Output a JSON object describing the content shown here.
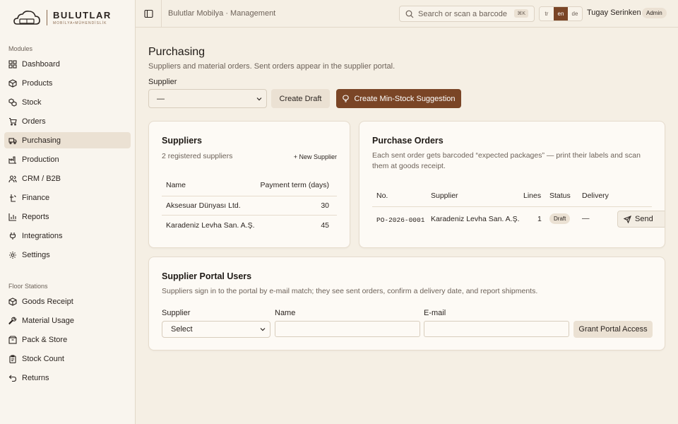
{
  "brand": {
    "name": "BULUTLAR",
    "tagline": "MOBİLYA•MÜHENDİSLİK"
  },
  "sidebar": {
    "modules_label": "Modules",
    "modules": [
      {
        "label": "Dashboard",
        "icon": "grid-icon"
      },
      {
        "label": "Products",
        "icon": "box-icon"
      },
      {
        "label": "Stock",
        "icon": "boxes-icon"
      },
      {
        "label": "Orders",
        "icon": "cart-icon"
      },
      {
        "label": "Purchasing",
        "icon": "truck-icon",
        "active": true
      },
      {
        "label": "Production",
        "icon": "factory-icon"
      },
      {
        "label": "CRM / B2B",
        "icon": "users-icon"
      },
      {
        "label": "Finance",
        "icon": "finance-icon"
      },
      {
        "label": "Reports",
        "icon": "chart-icon"
      },
      {
        "label": "Integrations",
        "icon": "plug-icon"
      },
      {
        "label": "Settings",
        "icon": "gear-icon"
      }
    ],
    "floor_label": "Floor Stations",
    "floor": [
      {
        "label": "Goods Receipt",
        "icon": "package-in-icon"
      },
      {
        "label": "Material Usage",
        "icon": "wrench-icon"
      },
      {
        "label": "Pack & Store",
        "icon": "package-icon"
      },
      {
        "label": "Stock Count",
        "icon": "clipboard-icon"
      },
      {
        "label": "Returns",
        "icon": "undo-icon"
      }
    ]
  },
  "topbar": {
    "breadcrumb": "Bulutlar Mobilya · Management",
    "search_placeholder": "Search or scan a barcode",
    "search_shortcut": "⌘K",
    "languages": [
      "tr",
      "en",
      "de"
    ],
    "active_language": "en",
    "user_name": "Tugay Serinken",
    "user_role": "Admin"
  },
  "page": {
    "title": "Purchasing",
    "description": "Suppliers and material orders. Sent orders appear in the supplier portal.",
    "supplier_label": "Supplier",
    "supplier_value": "—",
    "create_draft": "Create Draft",
    "create_suggestion": "Create Min-Stock Suggestion"
  },
  "suppliers": {
    "title": "Suppliers",
    "count_text": "2 registered suppliers",
    "new_button": "+ New Supplier",
    "columns": [
      "Name",
      "Payment term (days)"
    ],
    "rows": [
      {
        "name": "Aksesuar Dünyası Ltd.",
        "term": "30"
      },
      {
        "name": "Karadeniz Levha San. A.Ş.",
        "term": "45"
      }
    ]
  },
  "purchase_orders": {
    "title": "Purchase Orders",
    "description": "Each sent order gets barcoded “expected packages” — print their labels and scan them at goods receipt.",
    "columns": [
      "No.",
      "Supplier",
      "Lines",
      "Status",
      "Delivery"
    ],
    "rows": [
      {
        "no": "PO-2026-0001",
        "supplier": "Karadeniz Levha San. A.Ş.",
        "lines": "1",
        "status": "Draft",
        "delivery": "—",
        "action": "Send"
      }
    ]
  },
  "portal": {
    "title": "Supplier Portal Users",
    "description": "Suppliers sign in to the portal by e-mail match; they see sent orders, confirm a delivery date, and report shipments.",
    "supplier_label": "Supplier",
    "supplier_value": "Select",
    "name_label": "Name",
    "email_label": "E-mail",
    "grant_button": "Grant Portal Access"
  },
  "colors": {
    "accent": "#7a4526",
    "background": "#f5efe4",
    "card": "#fdfaf5"
  }
}
